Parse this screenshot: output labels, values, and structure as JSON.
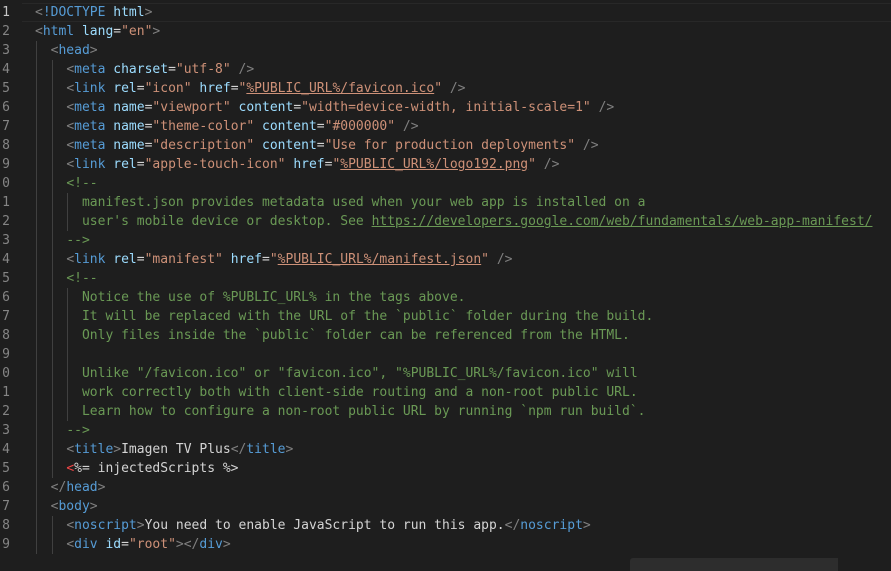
{
  "editor": {
    "language": "html",
    "active_line_number": "1",
    "lines": [
      {
        "n": "1",
        "indent": 0,
        "tokens": [
          [
            "punct",
            "<"
          ],
          [
            "tag",
            "!DOCTYPE"
          ],
          [
            "text",
            " "
          ],
          [
            "attr",
            "html"
          ],
          [
            "punct",
            ">"
          ]
        ]
      },
      {
        "n": "2",
        "indent": 0,
        "tokens": [
          [
            "punct",
            "<"
          ],
          [
            "tag",
            "html"
          ],
          [
            "text",
            " "
          ],
          [
            "attr",
            "lang"
          ],
          [
            "text",
            "="
          ],
          [
            "str",
            "\"en\""
          ],
          [
            "punct",
            ">"
          ]
        ]
      },
      {
        "n": "3",
        "indent": 1,
        "tokens": [
          [
            "punct",
            "<"
          ],
          [
            "tag",
            "head"
          ],
          [
            "punct",
            ">"
          ]
        ]
      },
      {
        "n": "4",
        "indent": 2,
        "tokens": [
          [
            "punct",
            "<"
          ],
          [
            "tag",
            "meta"
          ],
          [
            "text",
            " "
          ],
          [
            "attr",
            "charset"
          ],
          [
            "text",
            "="
          ],
          [
            "str",
            "\"utf-8\""
          ],
          [
            "text",
            " "
          ],
          [
            "punct",
            "/>"
          ]
        ]
      },
      {
        "n": "5",
        "indent": 2,
        "tokens": [
          [
            "punct",
            "<"
          ],
          [
            "tag",
            "link"
          ],
          [
            "text",
            " "
          ],
          [
            "attr",
            "rel"
          ],
          [
            "text",
            "="
          ],
          [
            "str",
            "\"icon\""
          ],
          [
            "text",
            " "
          ],
          [
            "attr",
            "href"
          ],
          [
            "text",
            "="
          ],
          [
            "str",
            "\""
          ],
          [
            "strlink",
            "%PUBLIC_URL%/favicon.ico"
          ],
          [
            "str",
            "\""
          ],
          [
            "text",
            " "
          ],
          [
            "punct",
            "/>"
          ]
        ]
      },
      {
        "n": "6",
        "indent": 2,
        "tokens": [
          [
            "punct",
            "<"
          ],
          [
            "tag",
            "meta"
          ],
          [
            "text",
            " "
          ],
          [
            "attr",
            "name"
          ],
          [
            "text",
            "="
          ],
          [
            "str",
            "\"viewport\""
          ],
          [
            "text",
            " "
          ],
          [
            "attr",
            "content"
          ],
          [
            "text",
            "="
          ],
          [
            "str",
            "\"width=device-width, initial-scale=1\""
          ],
          [
            "text",
            " "
          ],
          [
            "punct",
            "/>"
          ]
        ]
      },
      {
        "n": "7",
        "indent": 2,
        "tokens": [
          [
            "punct",
            "<"
          ],
          [
            "tag",
            "meta"
          ],
          [
            "text",
            " "
          ],
          [
            "attr",
            "name"
          ],
          [
            "text",
            "="
          ],
          [
            "str",
            "\"theme-color\""
          ],
          [
            "text",
            " "
          ],
          [
            "attr",
            "content"
          ],
          [
            "text",
            "="
          ],
          [
            "str",
            "\"#000000\""
          ],
          [
            "text",
            " "
          ],
          [
            "punct",
            "/>"
          ]
        ]
      },
      {
        "n": "8",
        "indent": 2,
        "tokens": [
          [
            "punct",
            "<"
          ],
          [
            "tag",
            "meta"
          ],
          [
            "text",
            " "
          ],
          [
            "attr",
            "name"
          ],
          [
            "text",
            "="
          ],
          [
            "str",
            "\"description\""
          ],
          [
            "text",
            " "
          ],
          [
            "attr",
            "content"
          ],
          [
            "text",
            "="
          ],
          [
            "str",
            "\"Use for production deployments\""
          ],
          [
            "text",
            " "
          ],
          [
            "punct",
            "/>"
          ]
        ]
      },
      {
        "n": "9",
        "indent": 2,
        "tokens": [
          [
            "punct",
            "<"
          ],
          [
            "tag",
            "link"
          ],
          [
            "text",
            " "
          ],
          [
            "attr",
            "rel"
          ],
          [
            "text",
            "="
          ],
          [
            "str",
            "\"apple-touch-icon\""
          ],
          [
            "text",
            " "
          ],
          [
            "attr",
            "href"
          ],
          [
            "text",
            "="
          ],
          [
            "str",
            "\""
          ],
          [
            "strlink",
            "%PUBLIC_URL%/logo192.png"
          ],
          [
            "str",
            "\""
          ],
          [
            "text",
            " "
          ],
          [
            "punct",
            "/>"
          ]
        ]
      },
      {
        "n": "0",
        "indent": 2,
        "tokens": [
          [
            "cmt",
            "<!--"
          ]
        ]
      },
      {
        "n": "1",
        "indent": 3,
        "tokens": [
          [
            "cmt",
            "manifest.json provides metadata used when your web app is installed on a"
          ]
        ]
      },
      {
        "n": "2",
        "indent": 3,
        "tokens": [
          [
            "cmt",
            "user's mobile device or desktop. See "
          ],
          [
            "cmtlink",
            "https://developers.google.com/web/fundamentals/web-app-manifest/"
          ]
        ]
      },
      {
        "n": "3",
        "indent": 2,
        "tokens": [
          [
            "cmt",
            "-->"
          ]
        ]
      },
      {
        "n": "4",
        "indent": 2,
        "tokens": [
          [
            "punct",
            "<"
          ],
          [
            "tag",
            "link"
          ],
          [
            "text",
            " "
          ],
          [
            "attr",
            "rel"
          ],
          [
            "text",
            "="
          ],
          [
            "str",
            "\"manifest\""
          ],
          [
            "text",
            " "
          ],
          [
            "attr",
            "href"
          ],
          [
            "text",
            "="
          ],
          [
            "str",
            "\""
          ],
          [
            "strlink",
            "%PUBLIC_URL%/manifest.json"
          ],
          [
            "str",
            "\""
          ],
          [
            "text",
            " "
          ],
          [
            "punct",
            "/>"
          ]
        ]
      },
      {
        "n": "5",
        "indent": 2,
        "tokens": [
          [
            "cmt",
            "<!--"
          ]
        ]
      },
      {
        "n": "6",
        "indent": 3,
        "tokens": [
          [
            "cmt",
            "Notice the use of %PUBLIC_URL% in the tags above."
          ]
        ]
      },
      {
        "n": "7",
        "indent": 3,
        "tokens": [
          [
            "cmt",
            "It will be replaced with the URL of the `public` folder during the build."
          ]
        ]
      },
      {
        "n": "8",
        "indent": 3,
        "tokens": [
          [
            "cmt",
            "Only files inside the `public` folder can be referenced from the HTML."
          ]
        ]
      },
      {
        "n": "9",
        "indent": 3,
        "tokens": []
      },
      {
        "n": "0",
        "indent": 3,
        "tokens": [
          [
            "cmt",
            "Unlike \"/favicon.ico\" or \"favicon.ico\", \"%PUBLIC_URL%/favicon.ico\" will"
          ]
        ]
      },
      {
        "n": "1",
        "indent": 3,
        "tokens": [
          [
            "cmt",
            "work correctly both with client-side routing and a non-root public URL."
          ]
        ]
      },
      {
        "n": "2",
        "indent": 3,
        "tokens": [
          [
            "cmt",
            "Learn how to configure a non-root public URL by running `npm run build`."
          ]
        ]
      },
      {
        "n": "3",
        "indent": 2,
        "tokens": [
          [
            "cmt",
            "-->"
          ]
        ]
      },
      {
        "n": "4",
        "indent": 2,
        "tokens": [
          [
            "punct",
            "<"
          ],
          [
            "tag",
            "title"
          ],
          [
            "punct",
            ">"
          ],
          [
            "text",
            "Imagen TV Plus"
          ],
          [
            "punct",
            "</"
          ],
          [
            "tag",
            "title"
          ],
          [
            "punct",
            ">"
          ]
        ]
      },
      {
        "n": "5",
        "indent": 2,
        "tokens": [
          [
            "asp",
            "<"
          ],
          [
            "text",
            "%= injectedScripts %>"
          ]
        ]
      },
      {
        "n": "6",
        "indent": 1,
        "tokens": [
          [
            "punct",
            "</"
          ],
          [
            "tag",
            "head"
          ],
          [
            "punct",
            ">"
          ]
        ]
      },
      {
        "n": "7",
        "indent": 1,
        "tokens": [
          [
            "punct",
            "<"
          ],
          [
            "tag",
            "body"
          ],
          [
            "punct",
            ">"
          ]
        ]
      },
      {
        "n": "8",
        "indent": 2,
        "tokens": [
          [
            "punct",
            "<"
          ],
          [
            "tag",
            "noscript"
          ],
          [
            "punct",
            ">"
          ],
          [
            "text",
            "You need to enable JavaScript to run this app."
          ],
          [
            "punct",
            "</"
          ],
          [
            "tag",
            "noscript"
          ],
          [
            "punct",
            ">"
          ]
        ]
      },
      {
        "n": "9",
        "indent": 2,
        "tokens": [
          [
            "punct",
            "<"
          ],
          [
            "tag",
            "div"
          ],
          [
            "text",
            " "
          ],
          [
            "attr",
            "id"
          ],
          [
            "text",
            "="
          ],
          [
            "str",
            "\"root\""
          ],
          [
            "punct",
            "></"
          ],
          [
            "tag",
            "div"
          ],
          [
            "punct",
            ">"
          ]
        ]
      }
    ]
  },
  "colors": {
    "background": "#1e1e1e",
    "tag": "#569cd6",
    "attribute": "#9cdcfe",
    "string": "#ce9178",
    "comment": "#6a9955",
    "punctuation": "#808080",
    "text": "#d4d4d4",
    "line_number": "#858585"
  }
}
